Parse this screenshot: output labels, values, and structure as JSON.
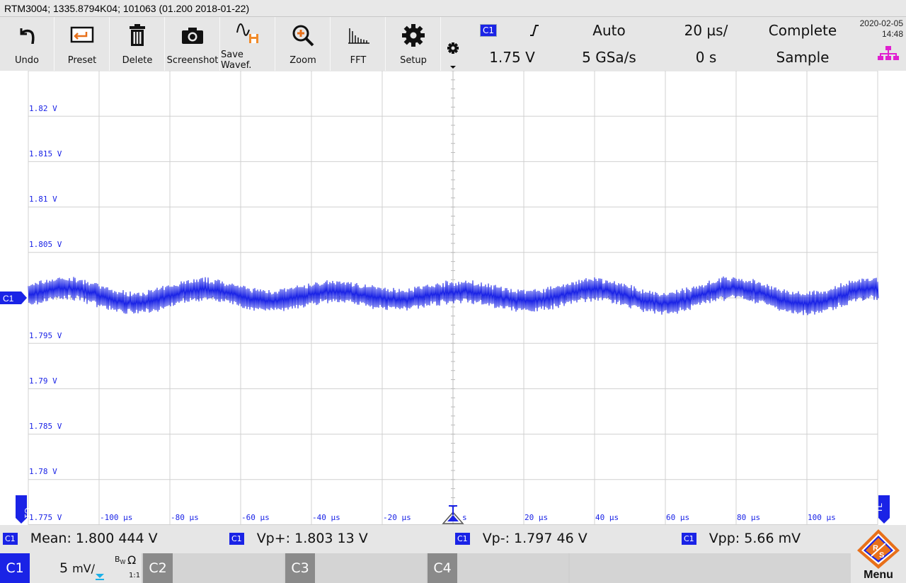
{
  "title": "RTM3004; 1335.8794K04; 101063 (01.200 2018-01-22)",
  "toolbar": {
    "buttons": [
      {
        "label": "Undo",
        "icon": "undo-icon"
      },
      {
        "label": "Preset",
        "icon": "preset-icon"
      },
      {
        "label": "Delete",
        "icon": "trash-icon"
      },
      {
        "label": "Screenshot",
        "icon": "camera-icon"
      },
      {
        "label": "Save Wavef.",
        "icon": "save-waveform-icon"
      },
      {
        "label": "Zoom",
        "icon": "zoom-icon"
      },
      {
        "label": "FFT",
        "icon": "fft-icon"
      },
      {
        "label": "Setup",
        "icon": "gear-icon"
      }
    ]
  },
  "status": {
    "trigger_source": "C1",
    "trigger_level": "1.75 V",
    "trigger_mode": "Auto",
    "sample_rate": "5 GSa/s",
    "time_scale": "20 µs/",
    "time_offset": "0 s",
    "acq_state": "Complete",
    "acq_mode": "Sample",
    "date": "2020-02-05",
    "time": "14:48"
  },
  "plot": {
    "channel_label": "C1",
    "y_labels": [
      "1.82 V",
      "1.815 V",
      "1.81 V",
      "1.805 V",
      "1.795 V",
      "1.79 V",
      "1.785 V",
      "1.78 V",
      "1.775 V"
    ],
    "x_labels": [
      "-100 µs",
      "-80 µs",
      "-60 µs",
      "-40 µs",
      "-20 µs",
      "s",
      "20 µs",
      "40 µs",
      "60 µs",
      "80 µs",
      "100 µs"
    ],
    "left_marker": "C1",
    "right_marker": "TL",
    "trace_color": "#1a23e6"
  },
  "measurements": [
    {
      "tag": "C1",
      "text": "Mean: 1.800 444 V"
    },
    {
      "tag": "C1",
      "text": "Vp+: 1.803 13 V"
    },
    {
      "tag": "C1",
      "text": "Vp-: 1.797 46 V"
    },
    {
      "tag": "C1",
      "text": "Vpp: 5.66 mV"
    }
  ],
  "channels": {
    "c1": "C1",
    "c1_scale": "5",
    "c1_unit": "mV/",
    "c1_bw": "B",
    "c1_bw_sub": "W",
    "c1_imp": "Ω",
    "c1_probe": "1:1",
    "c2": "C2",
    "c3": "C3",
    "c4": "C4"
  },
  "menu_label": "Menu"
}
